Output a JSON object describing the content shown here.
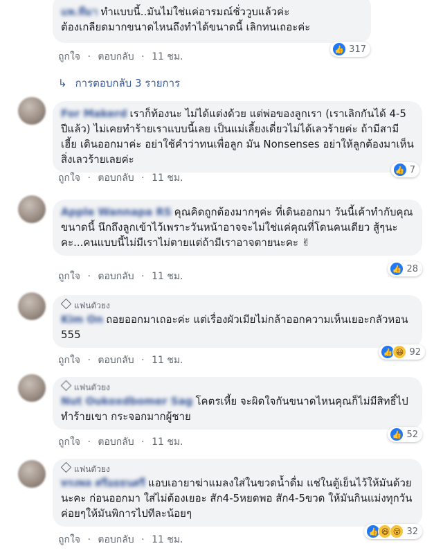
{
  "actions": {
    "like": "ถูกใจ",
    "reply": "ตอบกลับ",
    "sep": "·"
  },
  "replies_link": "การตอบกลับ 3 รายการ",
  "comments": [
    {
      "name": "แพ.ทีมา",
      "text": "ทำแบบนี้..มันไม่ใช่แค่อารมณ์ชั่ววูบแล้วค่ะ\nต้องเกลียดมากขนาดไหนถึงทำได้ขนาดนี้ เลิกทนเถอะค่ะ",
      "time": "11 ชม.",
      "count": "317",
      "reactions": [
        "like"
      ],
      "fan": ""
    },
    {
      "name": "For Makerd",
      "text": "เราก็ท้องนะ ไม่ได้แต่งด้วย แต่พ่อของลูกเรา (เราเลิกกันได้ 4-5 ปีแล้ว) ไม่เคยทำร้ายเราแบบนี้เลย เป็นแม่เลี้ยงเดี่ยวไม่ได้เลวร้ายค่ะ ถ้ามีสามีเฮี้ย เดินออกมาค่ะ อย่าใช้คำว่าทนเพื่อลูก มัน Nonsenses อย่าให้ลูกต้องมาเห็นสิ่งเลวร้ายเลยค่ะ",
      "time": "11 ชม.",
      "count": "7",
      "reactions": [
        "like"
      ],
      "fan": ""
    },
    {
      "name": "Apple Wannapa RS",
      "text": "คุณคิดถูกต้องมากๆค่ะ ที่เดินออกมา วันนี้เค้าทำกับคุณขนาดนี้ นึกถึงลูกเข้าไว้เพราะวันหน้าอาจจะไม่ใช่แค่คุณที่โดนคนเดียว สู้ๆนะคะ...คนแบบนี้ไม่มีเราไม่ตายแต่ถ้ามีเราอาจตายนะคะ ✌",
      "time": "11 ชม.",
      "count": "28",
      "reactions": [
        "like"
      ],
      "fan": ""
    },
    {
      "name": "Kim On",
      "text": "ถอยออกมาเถอะค่ะ แต่เรื่องผัวเมียไม่กล้าออกความเห็นเยอะกลัวหอน 555",
      "time": "11 ชม.",
      "count": "92",
      "reactions": [
        "like",
        "haha"
      ],
      "fan": "แฟนตัวยง"
    },
    {
      "name": "Nut Oukoxdbomer Sag",
      "text": "โคตรเหี้ย จะผิดใจกันขนาดไหนคุณก็ไม่มีสิทธิ์ไปทำร้ายเขา กระจอกมากผู้ชาย",
      "time": "11 ชม.",
      "count": "52",
      "reactions": [
        "like"
      ],
      "fan": "แฟนตัวยง"
    },
    {
      "name": "ทรงพล ศรีอยธนศรี",
      "text": "แอบเอายาฆ่าแมลงใส่ในขวดน้ำดื่ม แช่ในตู้เย็นไว้ให้มันด้วยนะคะ ก่อนออกมา ใส่ไม่ต้องเยอะ สัก4-5หยดพอ สัก4-5ขวด ให้มันกินแม่งทุกวัน ค่อยๆให้มันพิการไปทีละน้อยๆ",
      "time": "11 ชม.",
      "count": "32",
      "reactions": [
        "like",
        "haha",
        "wow"
      ],
      "fan": "แฟนตัวยง"
    }
  ]
}
